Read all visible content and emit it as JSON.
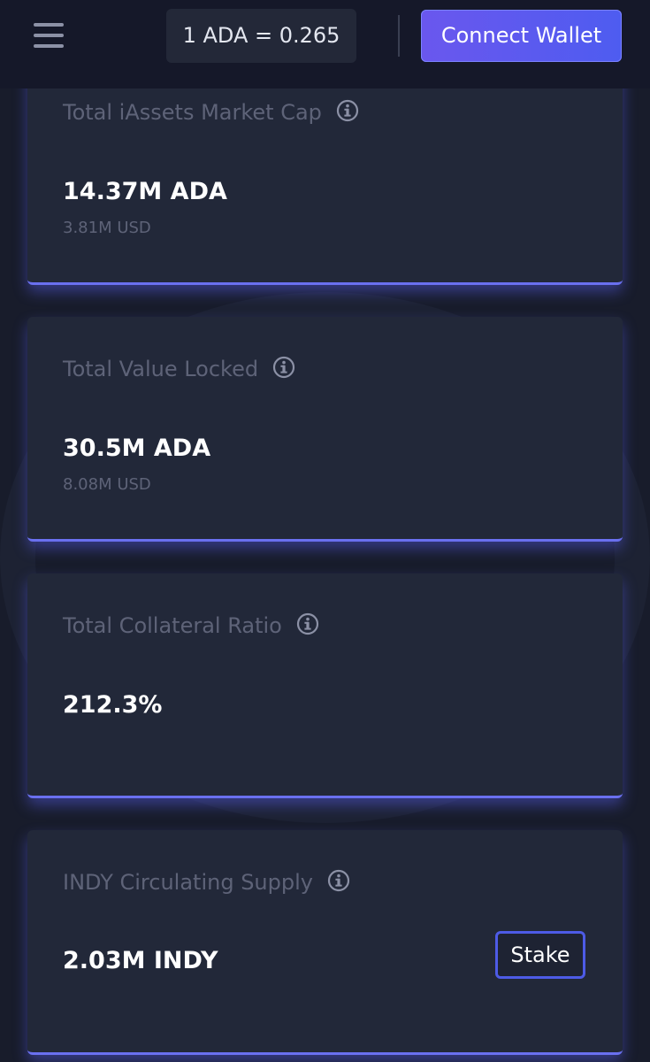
{
  "header": {
    "price_label": "1 ADA = 0.265",
    "connect_wallet_label": "Connect Wallet"
  },
  "cards": [
    {
      "title": "Total iAssets Market Cap",
      "value": "14.37M ADA",
      "sub": "3.81M USD"
    },
    {
      "title": "Total Value Locked",
      "value": "30.5M ADA",
      "sub": "8.08M USD"
    },
    {
      "title": "Total Collateral Ratio",
      "value": "212.3%"
    },
    {
      "title": "INDY Circulating Supply",
      "value": "2.03M INDY",
      "action_label": "Stake"
    }
  ],
  "icons": {
    "menu": "hamburger-menu-icon",
    "info": "info-circle-icon"
  },
  "colors": {
    "background": "#181c2b",
    "card": "#222839",
    "accent": "#5e5ef0",
    "muted_text": "#5e6378"
  }
}
